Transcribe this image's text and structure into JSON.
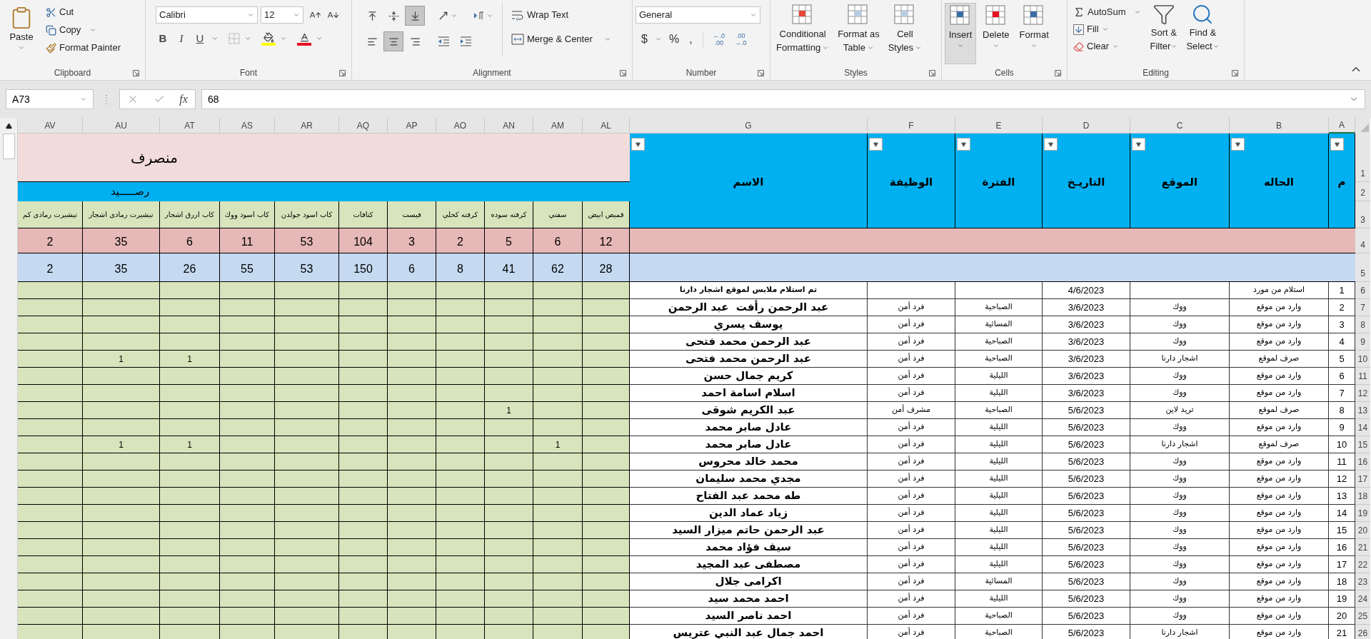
{
  "ribbon": {
    "clipboard": {
      "label": "Clipboard",
      "paste": "Paste",
      "cut": "Cut",
      "copy": "Copy",
      "format_painter": "Format Painter"
    },
    "font": {
      "label": "Font",
      "name": "Calibri",
      "size": "12",
      "style_buttons": [
        {
          "kind": "underline",
          "label": "U"
        },
        {
          "kind": "italic",
          "label": "I"
        },
        {
          "kind": "bold",
          "label": "B"
        }
      ]
    },
    "alignment": {
      "label": "Alignment",
      "wrap_text": "Wrap Text",
      "merge_center": "Merge & Center",
      "vertical": [
        {
          "kind": "bottom",
          "selected": true
        },
        {
          "kind": "middle",
          "selected": false
        },
        {
          "kind": "top",
          "selected": false
        }
      ],
      "horizontal": [
        {
          "kind": "right",
          "selected": false
        },
        {
          "kind": "center",
          "selected": true
        },
        {
          "kind": "left",
          "selected": false
        }
      ]
    },
    "number": {
      "label": "Number",
      "format": "General",
      "symbols": [
        ",",
        "%",
        "$"
      ],
      "decimals": [
        {
          "top": ".00",
          "bottom": "→.0"
        },
        {
          "top": "←.0",
          "bottom": ".00"
        }
      ]
    },
    "styles": {
      "label": "Styles",
      "buttons": [
        {
          "kind": "cell",
          "lines": [
            "Cell",
            "Styles"
          ]
        },
        {
          "kind": "table",
          "lines": [
            "Format as",
            "Table"
          ]
        },
        {
          "kind": "conditional",
          "lines": [
            "Conditional",
            "Formatting"
          ]
        }
      ]
    },
    "cells": {
      "label": "Cells",
      "buttons": [
        {
          "kind": "format",
          "label": "Format",
          "selected": false
        },
        {
          "kind": "delete",
          "label": "Delete",
          "selected": false
        },
        {
          "kind": "insert",
          "label": "Insert",
          "selected": true
        }
      ]
    },
    "editing": {
      "label": "Editing",
      "autosum": "AutoSum",
      "fill": "Fill",
      "clear": "Clear",
      "sort": [
        "Sort &",
        "Filter"
      ],
      "find": [
        "Find &",
        "Select"
      ]
    }
  },
  "formula_bar": {
    "name_box": "A73",
    "function_label": "fx",
    "value": "68"
  },
  "sheet": {
    "left_columns": [
      "AL",
      "AM",
      "AN",
      "AO",
      "AP",
      "AQ",
      "AR",
      "AS",
      "AT",
      "AU",
      "AV"
    ],
    "right_columns": [
      {
        "label": "A",
        "selected": true
      },
      {
        "label": "B",
        "selected": false
      },
      {
        "label": "C",
        "selected": false
      },
      {
        "label": "D",
        "selected": false
      },
      {
        "label": "E",
        "selected": false
      },
      {
        "label": "F",
        "selected": false
      },
      {
        "label": "G",
        "selected": false
      }
    ],
    "header_row_numbers": [
      "1",
      "2",
      "3",
      "4",
      "5"
    ],
    "spent_title": "منصرف",
    "balance_title": "رصـــــيد",
    "items": [
      {
        "kind": "shirt",
        "name": "قميص ابيض",
        "spent": "12",
        "balance": "28"
      },
      {
        "kind": "safety",
        "name": "سفتي",
        "spent": "6",
        "balance": "62"
      },
      {
        "kind": "tie_black",
        "name": "كرفته سوده",
        "spent": "5",
        "balance": "41"
      },
      {
        "kind": "tie_navy",
        "name": "كرفته كحلي",
        "spent": "2",
        "balance": "8"
      },
      {
        "kind": "vest",
        "name": "فيست",
        "spent": "3",
        "balance": "6"
      },
      {
        "kind": "epaulettes",
        "name": "كتافات",
        "spent": "104",
        "balance": "150"
      },
      {
        "kind": "cap_golden",
        "name": "كاب اسود جولدن",
        "spent": "53",
        "balance": "53"
      },
      {
        "kind": "cap_wook",
        "name": "كاب اسود ووك",
        "spent": "11",
        "balance": "55"
      },
      {
        "kind": "cap_blue",
        "name": "كاب ازرق اشجار",
        "spent": "6",
        "balance": "26"
      },
      {
        "kind": "tshirt_trees",
        "name": "تيشيرت رمادى اشجار",
        "spent": "35",
        "balance": "35"
      },
      {
        "kind": "tshirt_sleeve",
        "name": "تيشيرت رمادى كم",
        "spent": "2",
        "balance": "2"
      }
    ],
    "table_headers": [
      "م",
      "الحاله",
      "الموقع",
      "التاريـخ",
      "الفترة",
      "الوظيفة",
      "الاسم"
    ],
    "rows": [
      {
        "row_number": "6",
        "kind": "note",
        "number": "1",
        "status": "استلام من مورد",
        "date": "4/6/2023",
        "name": "تم استلام ملابس لموقع اشجار دارنا"
      },
      {
        "row_number": "7",
        "kind": "person",
        "number": "2",
        "status": "وارد من موقع",
        "location": "ووك",
        "date": "3/6/2023",
        "period": "الصباحية",
        "job": "فرد أمن",
        "name": "عبد الرحمن رأفت  عبد الرحمن"
      },
      {
        "row_number": "8",
        "kind": "person",
        "number": "3",
        "status": "وارد من موقع",
        "location": "ووك",
        "date": "3/6/2023",
        "period": "المسائية",
        "job": "فرد أمن",
        "name": "يوسف يسري"
      },
      {
        "row_number": "9",
        "kind": "person",
        "number": "4",
        "status": "وارد من موقع",
        "location": "ووك",
        "date": "3/6/2023",
        "period": "الصباحية",
        "job": "فرد أمن",
        "name": "عبد الرحمن محمد فتحى"
      },
      {
        "row_number": "10",
        "kind": "person",
        "number": "5",
        "status": "صرف لموقع",
        "location": "اشجار دارنا",
        "date": "3/6/2023",
        "period": "الصباحية",
        "job": "فرد أمن",
        "name": "عبد الرحمن محمد فتحى",
        "quantities": [
          {
            "kind": "cap_blue",
            "value": "1"
          },
          {
            "kind": "tshirt_trees",
            "value": "1"
          }
        ]
      },
      {
        "row_number": "11",
        "kind": "person",
        "number": "6",
        "status": "وارد من موقع",
        "location": "ووك",
        "date": "3/6/2023",
        "period": "الليلية",
        "job": "فرد أمن",
        "name": "كريم جمال حسن"
      },
      {
        "row_number": "12",
        "kind": "person",
        "number": "7",
        "status": "وارد من موقع",
        "location": "ووك",
        "date": "3/6/2023",
        "period": "الليلية",
        "job": "فرد أمن",
        "name": "اسلام اسامة احمد"
      },
      {
        "row_number": "13",
        "kind": "person",
        "number": "8",
        "status": "صرف لموقع",
        "location": "تريد لاين",
        "date": "5/6/2023",
        "period": "الصباحية",
        "job": "مشرف أمن",
        "name": "عبد الكريم شوقى",
        "quantities": [
          {
            "kind": "tie_black",
            "value": "1"
          }
        ]
      },
      {
        "row_number": "14",
        "kind": "person",
        "number": "9",
        "status": "وارد من موقع",
        "location": "ووك",
        "date": "5/6/2023",
        "period": "الليلية",
        "job": "فرد أمن",
        "name": "عادل صابر محمد"
      },
      {
        "row_number": "15",
        "kind": "person",
        "number": "10",
        "status": "صرف لموقع",
        "location": "اشجار دارنا",
        "date": "5/6/2023",
        "period": "الليلية",
        "job": "فرد أمن",
        "name": "عادل صابر محمد",
        "quantities": [
          {
            "kind": "safety",
            "value": "1"
          },
          {
            "kind": "cap_blue",
            "value": "1"
          },
          {
            "kind": "tshirt_trees",
            "value": "1"
          }
        ]
      },
      {
        "row_number": "16",
        "kind": "person",
        "number": "11",
        "status": "وارد من موقع",
        "location": "ووك",
        "date": "5/6/2023",
        "period": "الليلية",
        "job": "فرد أمن",
        "name": "محمد خالد محروس"
      },
      {
        "row_number": "17",
        "kind": "person",
        "number": "12",
        "status": "وارد من موقع",
        "location": "ووك",
        "date": "5/6/2023",
        "period": "الليلية",
        "job": "فرد أمن",
        "name": "مجدي محمد سليمان"
      },
      {
        "row_number": "18",
        "kind": "person",
        "number": "13",
        "status": "وارد من موقع",
        "location": "ووك",
        "date": "5/6/2023",
        "period": "الليلية",
        "job": "فرد أمن",
        "name": "طه محمد عبد الفتاح"
      },
      {
        "row_number": "19",
        "kind": "person",
        "number": "14",
        "status": "وارد من موقع",
        "location": "ووك",
        "date": "5/6/2023",
        "period": "الليلية",
        "job": "فرد أمن",
        "name": "زياد عماد الدين"
      },
      {
        "row_number": "20",
        "kind": "person",
        "number": "15",
        "status": "وارد من موقع",
        "location": "ووك",
        "date": "5/6/2023",
        "period": "الليلية",
        "job": "فرد أمن",
        "name": "عبد الرحمن حاتم ميزار السيد"
      },
      {
        "row_number": "21",
        "kind": "person",
        "number": "16",
        "status": "وارد من موقع",
        "location": "ووك",
        "date": "5/6/2023",
        "period": "الليلية",
        "job": "فرد أمن",
        "name": "سيف فؤاد محمد"
      },
      {
        "row_number": "22",
        "kind": "person",
        "number": "17",
        "status": "وارد من موقع",
        "location": "ووك",
        "date": "5/6/2023",
        "period": "الليلية",
        "job": "فرد أمن",
        "name": "مصطفى عبد المجيد"
      },
      {
        "row_number": "23",
        "kind": "person",
        "number": "18",
        "status": "وارد من موقع",
        "location": "ووك",
        "date": "5/6/2023",
        "period": "المسائية",
        "job": "فرد أمن",
        "name": "اكرامى جلال"
      },
      {
        "row_number": "24",
        "kind": "person",
        "number": "19",
        "status": "وارد من موقع",
        "location": "ووك",
        "date": "5/6/2023",
        "period": "الليلية",
        "job": "فرد أمن",
        "name": "احمد محمد سيد"
      },
      {
        "row_number": "25",
        "kind": "person",
        "number": "20",
        "status": "وارد من موقع",
        "location": "ووك",
        "date": "5/6/2023",
        "period": "الصباحية",
        "job": "فرد أمن",
        "name": "احمد ناصر السيد"
      },
      {
        "row_number": "26",
        "kind": "person",
        "number": "21",
        "status": "وارد من موقع",
        "location": "اشجار دارنا",
        "date": "5/6/2023",
        "period": "الصباحية",
        "job": "فرد أمن",
        "name": "احمد جمال عبد النبي عتريس"
      }
    ]
  }
}
